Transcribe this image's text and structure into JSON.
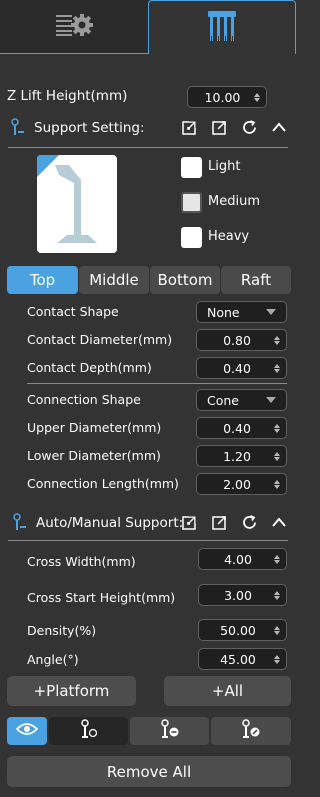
{
  "tabs": [
    {
      "name": "settings-tab",
      "icon": "print-settings-icon"
    },
    {
      "name": "support-tab",
      "icon": "support-structure-icon",
      "active": true
    }
  ],
  "z_lift": {
    "label": "Z Lift Height(mm)",
    "value": "10.00"
  },
  "support_setting": {
    "title": "Support Setting:",
    "density_options": [
      {
        "label": "Light",
        "checked": false
      },
      {
        "label": "Medium",
        "checked": true
      },
      {
        "label": "Heavy",
        "checked": false
      }
    ]
  },
  "segments": [
    "Top",
    "Middle",
    "Bottom",
    "Raft"
  ],
  "top_params": {
    "contact_shape": {
      "label": "Contact Shape",
      "value": "None"
    },
    "contact_diameter": {
      "label": "Contact Diameter(mm)",
      "value": "0.80"
    },
    "contact_depth": {
      "label": "Contact Depth(mm)",
      "value": "0.40"
    },
    "connection_shape": {
      "label": "Connection Shape",
      "value": "Cone"
    },
    "upper_diameter": {
      "label": "Upper Diameter(mm)",
      "value": "0.40"
    },
    "lower_diameter": {
      "label": "Lower Diameter(mm)",
      "value": "1.20"
    },
    "connection_length": {
      "label": "Connection Length(mm)",
      "value": "2.00"
    }
  },
  "auto_manual": {
    "title": "Auto/Manual Support:",
    "cross_width": {
      "label": "Cross Width(mm)",
      "value": "4.00"
    },
    "cross_start_height": {
      "label": "Cross Start Height(mm)",
      "value": "3.00"
    },
    "density": {
      "label": "Density(%)",
      "value": "50.00"
    },
    "angle": {
      "label": "Angle(°)",
      "value": "45.00"
    }
  },
  "buttons": {
    "platform": "+Platform",
    "all": "+All",
    "remove_all": "Remove All"
  },
  "colors": {
    "accent": "#4aa3e0",
    "panel": "#333333",
    "button": "#4a4a4a"
  }
}
